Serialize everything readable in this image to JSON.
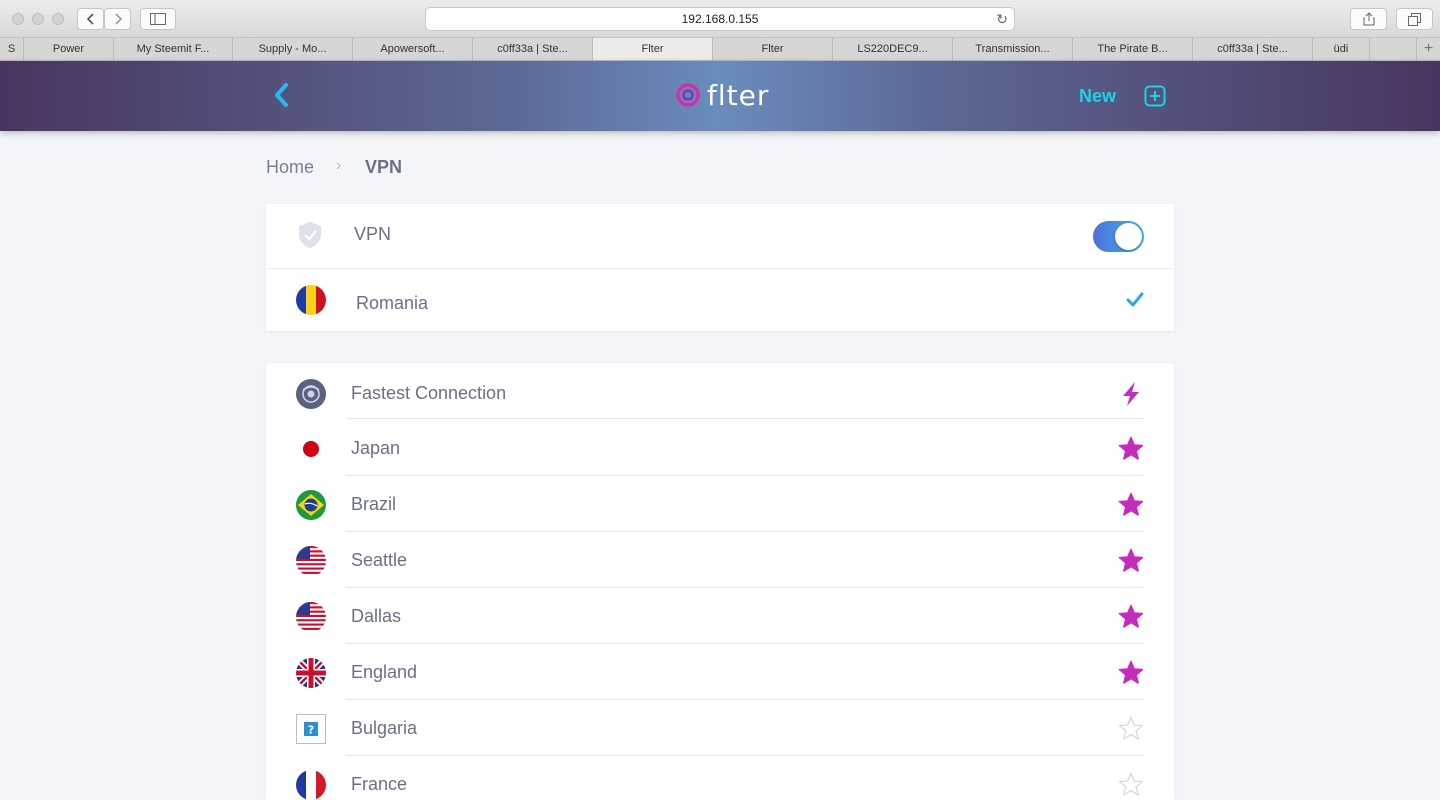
{
  "browser": {
    "url": "192.168.0.155",
    "tabs": [
      {
        "label": "S",
        "width": 24
      },
      {
        "label": "Power",
        "width": 90
      },
      {
        "label": "My Steemit F...",
        "width": 119
      },
      {
        "label": "Supply - Mo...",
        "width": 120
      },
      {
        "label": "Apowersoft...",
        "width": 120
      },
      {
        "label": "c0ff33a | Ste...",
        "width": 120
      },
      {
        "label": "Flter",
        "width": 120,
        "active": true
      },
      {
        "label": "Flter",
        "width": 120
      },
      {
        "label": "LS220DEC9...",
        "width": 120
      },
      {
        "label": "Transmission...",
        "width": 120
      },
      {
        "label": "The Pirate B...",
        "width": 120
      },
      {
        "label": "c0ff33a | Ste...",
        "width": 120
      },
      {
        "label": "üdi",
        "width": 57
      }
    ]
  },
  "header": {
    "logo_text": "flter",
    "new_label": "New"
  },
  "breadcrumb": {
    "home": "Home",
    "separator": "›",
    "current": "VPN"
  },
  "vpn_card": {
    "toggle_label": "VPN",
    "toggle_on": true,
    "selected_country": "Romania"
  },
  "servers": [
    {
      "label": "Fastest Connection",
      "flag": "globe",
      "icon": "bolt"
    },
    {
      "label": "Japan",
      "flag": "jp",
      "icon": "star-filled"
    },
    {
      "label": "Brazil",
      "flag": "br",
      "icon": "star-filled"
    },
    {
      "label": "Seattle",
      "flag": "us",
      "icon": "star-filled"
    },
    {
      "label": "Dallas",
      "flag": "us",
      "icon": "star-filled"
    },
    {
      "label": "England",
      "flag": "gb",
      "icon": "star-filled"
    },
    {
      "label": "Bulgaria",
      "flag": "unknown",
      "icon": "star-outline"
    },
    {
      "label": "France",
      "flag": "fr",
      "icon": "star-outline"
    }
  ],
  "colors": {
    "accent": "#19d3e6",
    "star": "#c42dbb",
    "check": "#2ca9e1"
  }
}
